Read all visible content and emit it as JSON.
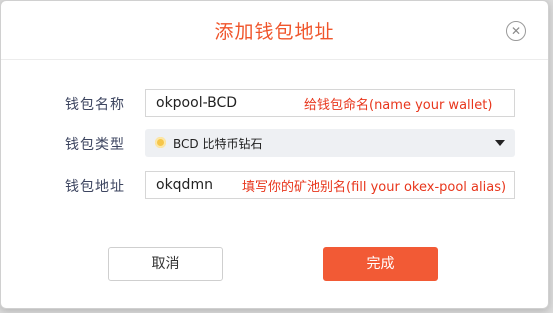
{
  "dialog": {
    "title": "添加钱包地址"
  },
  "form": {
    "name_label": "钱包名称",
    "name_value": "okpool-BCD",
    "name_hint": "给钱包命名(name your wallet)",
    "type_label": "钱包类型",
    "type_value": "BCD 比特币钻石",
    "type_icon": "bcd-coin-icon",
    "address_label": "钱包地址",
    "address_value": "okqdmn",
    "address_hint": "填写你的矿池别名(fill your okex-pool alias)"
  },
  "buttons": {
    "cancel": "取消",
    "confirm": "完成"
  },
  "colors": {
    "accent": "#f25a35",
    "title": "#f0552b",
    "hint": "#e8361c"
  }
}
